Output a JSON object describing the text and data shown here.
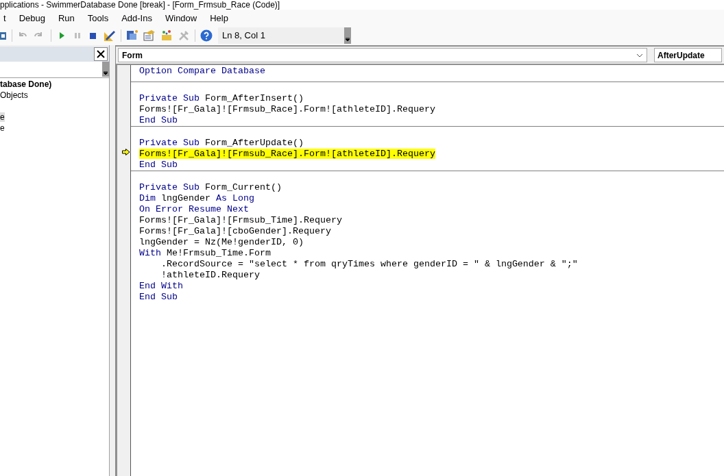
{
  "window": {
    "title": "pplications - SwimmerDatabase Done [break] - [Form_Frmsub_Race (Code)]"
  },
  "menu": [
    "t",
    "Debug",
    "Run",
    "Tools",
    "Add-Ins",
    "Window",
    "Help"
  ],
  "toolbar": {
    "position": "Ln 8, Col 1"
  },
  "project_pane": {
    "tree": [
      {
        "label": "tabase Done)",
        "children": [
          {
            "label": "Objects",
            "children": [
              {
                "label": "e",
                "selected": true
              },
              {
                "label": "e",
                "selected": false
              }
            ]
          }
        ]
      }
    ]
  },
  "code_window": {
    "object": "Form",
    "procedure": "AfterUpdate",
    "procedures": [
      {
        "lines": [
          {
            "current": false,
            "tokens": [
              {
                "text": "Option Compare Database",
                "keyword": true
              }
            ]
          }
        ]
      },
      {
        "lines": [
          {
            "current": false,
            "tokens": [
              {
                "text": "Private Sub",
                "keyword": true
              },
              {
                "text": " Form_AfterInsert()",
                "keyword": false
              }
            ]
          },
          {
            "current": false,
            "tokens": [
              {
                "text": "Forms![Fr_Gala]![Frmsub_Race].Form![athleteID].Requery",
                "keyword": false
              }
            ]
          },
          {
            "current": false,
            "tokens": [
              {
                "text": "End Sub",
                "keyword": true
              }
            ]
          }
        ]
      },
      {
        "lines": [
          {
            "current": false,
            "tokens": [
              {
                "text": "Private Sub",
                "keyword": true
              },
              {
                "text": " Form_AfterUpdate()",
                "keyword": false
              }
            ]
          },
          {
            "current": true,
            "tokens": [
              {
                "text": "Forms![Fr_Gala]![Frmsub_Race].Form![athleteID].Requery",
                "keyword": false
              }
            ]
          },
          {
            "current": false,
            "tokens": [
              {
                "text": "End Sub",
                "keyword": true
              }
            ]
          }
        ]
      },
      {
        "lines": [
          {
            "current": false,
            "tokens": [
              {
                "text": "Private Sub",
                "keyword": true
              },
              {
                "text": " Form_Current()",
                "keyword": false
              }
            ]
          },
          {
            "current": false,
            "tokens": [
              {
                "text": "Dim",
                "keyword": true
              },
              {
                "text": " lngGender ",
                "keyword": false
              },
              {
                "text": "As Long",
                "keyword": true
              }
            ]
          },
          {
            "current": false,
            "tokens": [
              {
                "text": "On Error Resume Next",
                "keyword": true
              }
            ]
          },
          {
            "current": false,
            "tokens": [
              {
                "text": "Forms![Fr_Gala]![Frmsub_Time].Requery",
                "keyword": false
              }
            ]
          },
          {
            "current": false,
            "tokens": [
              {
                "text": "Forms![Fr_Gala]![cboGender].Requery",
                "keyword": false
              }
            ]
          },
          {
            "current": false,
            "tokens": [
              {
                "text": "lngGender = Nz(Me!genderID, 0)",
                "keyword": false
              }
            ]
          },
          {
            "current": false,
            "tokens": [
              {
                "text": "With",
                "keyword": true
              },
              {
                "text": " Me!Frmsub_Time.Form",
                "keyword": false
              }
            ]
          },
          {
            "current": false,
            "tokens": [
              {
                "text": "    .RecordSource = \"select * from qryTimes where genderID = \" & lngGender & \";\"",
                "keyword": false
              }
            ]
          },
          {
            "current": false,
            "tokens": [
              {
                "text": "    !athleteID.Requery",
                "keyword": false
              }
            ]
          },
          {
            "current": false,
            "tokens": [
              {
                "text": "End With",
                "keyword": true
              }
            ]
          },
          {
            "current": false,
            "tokens": [
              {
                "text": "End Sub",
                "keyword": true
              }
            ]
          }
        ]
      }
    ]
  }
}
